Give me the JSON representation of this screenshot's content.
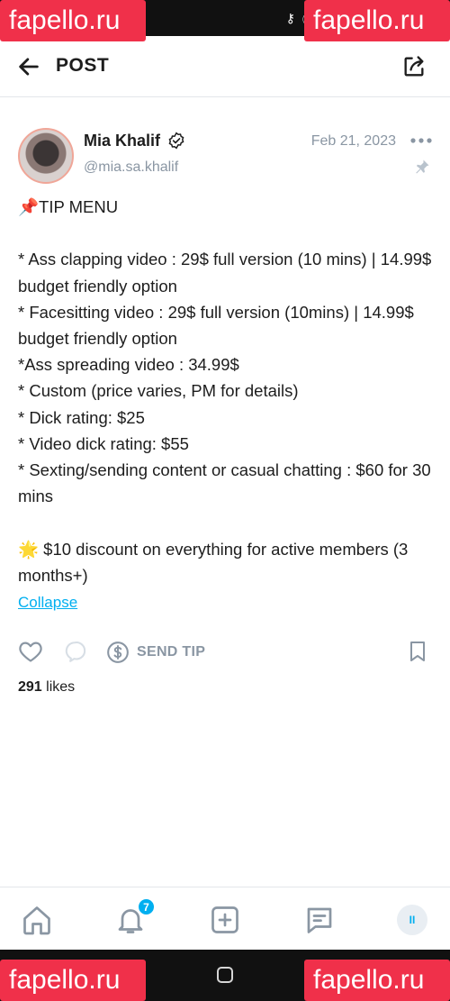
{
  "status_bar": {
    "icons": [
      "key-icon",
      "nfc-icon"
    ]
  },
  "watermark": {
    "text": "fapello.ru"
  },
  "header": {
    "title": "POST"
  },
  "post": {
    "author": {
      "name": "Mia Khalif",
      "handle": "@mia.sa.khalif",
      "verified": true
    },
    "date": "Feb 21, 2023",
    "body_lines": [
      "📌TIP MENU",
      "",
      "* Ass clapping video : 29$ full version (10 mins) | 14.99$ budget friendly option",
      "* Facesitting video : 29$ full version (10mins) | 14.99$ budget friendly option",
      "*Ass spreading video : 34.99$",
      "* Custom (price varies, PM for details)",
      "* Dick rating: $25",
      "* Video dick rating: $55",
      "* Sexting/sending content or casual chatting : $60 for 30 mins",
      "",
      "🌟 $10 discount on everything for active members (3 months+)"
    ],
    "collapse_label": "Collapse",
    "send_tip_label": "SEND TIP",
    "likes_count": "291",
    "likes_label": "likes"
  },
  "bottom_nav": {
    "notification_count": "7",
    "profile_initials": "II"
  },
  "colors": {
    "accent": "#00aff0",
    "muted": "#8a96a3",
    "watermark": "#f0304a"
  }
}
